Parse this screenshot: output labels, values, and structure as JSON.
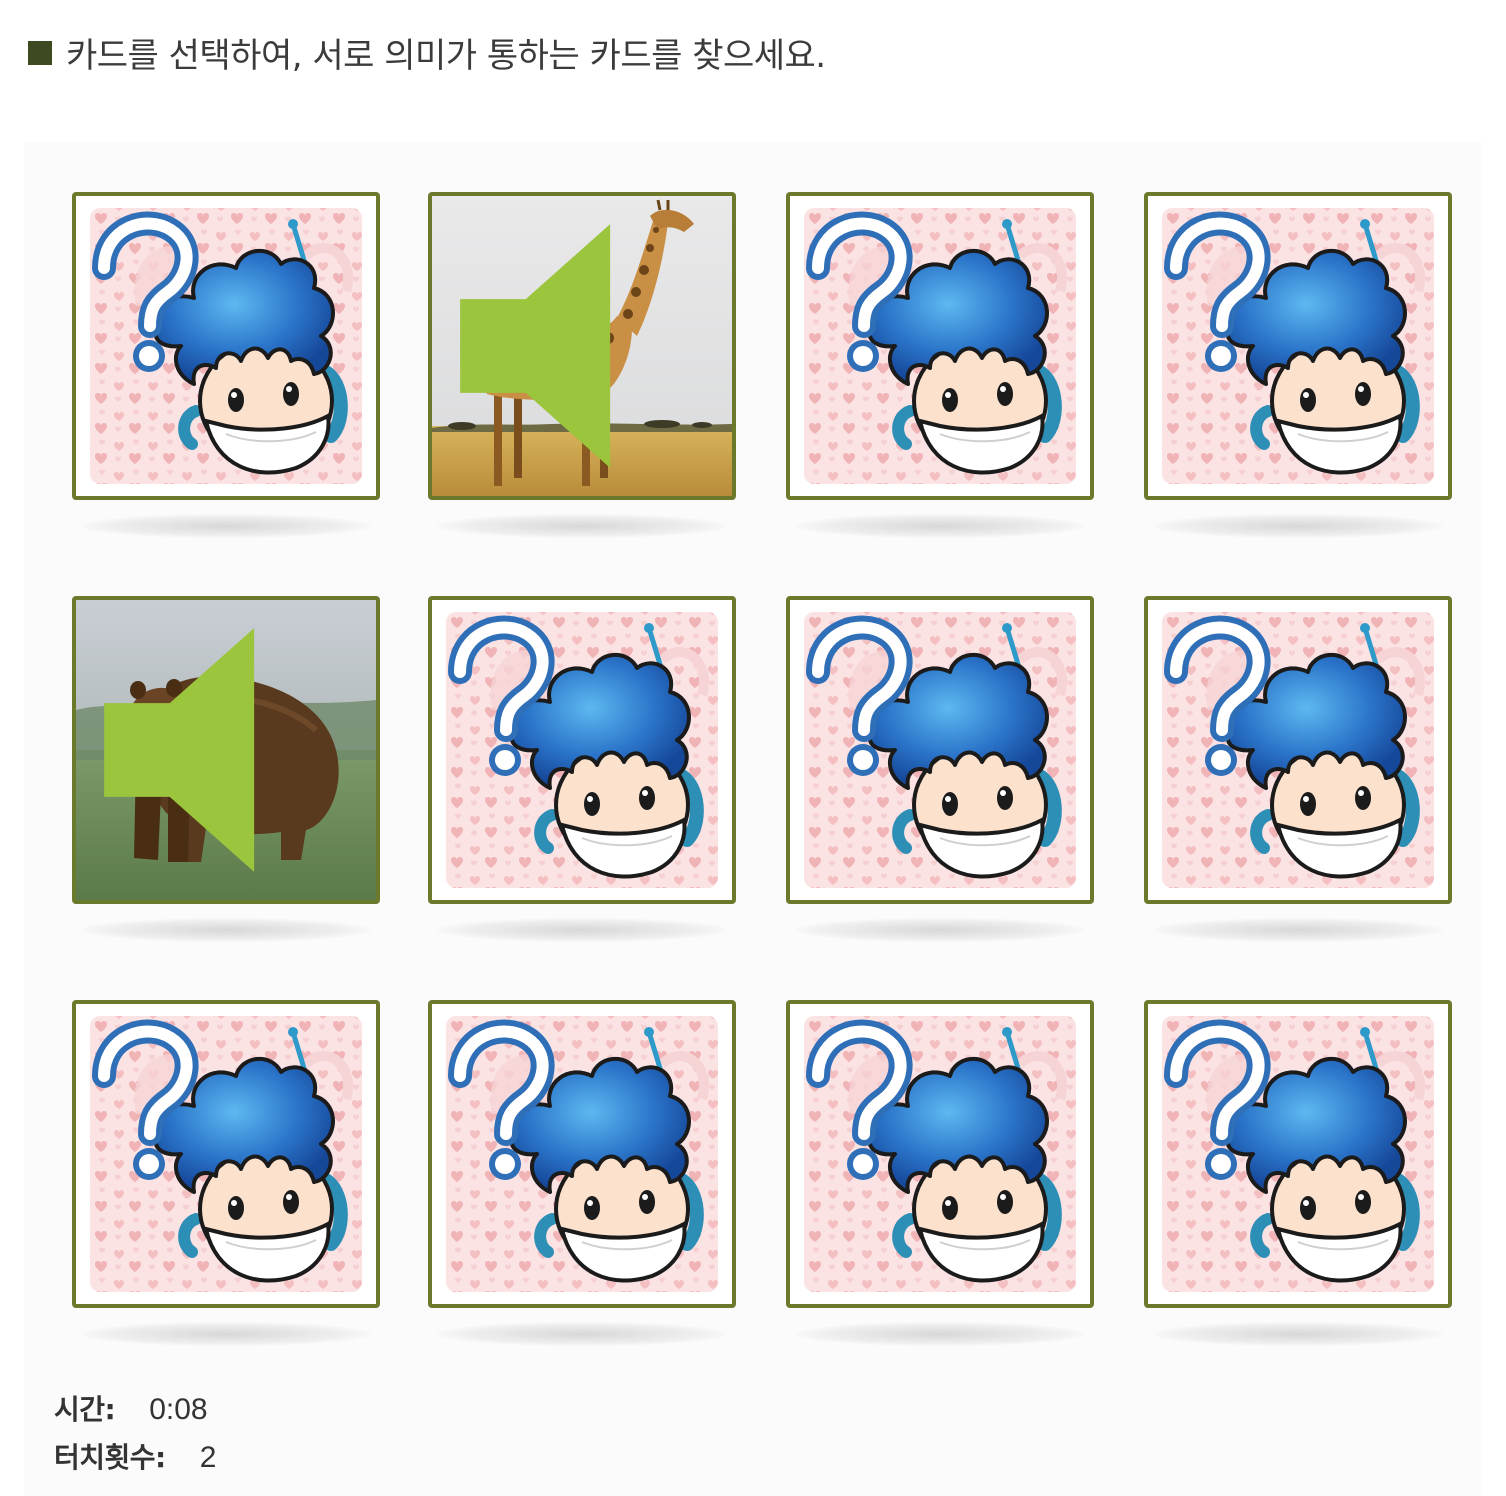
{
  "instruction": {
    "text": "카드를 선택하여, 서로 의미가 통하는 카드를 찾으세요."
  },
  "cards": [
    {
      "state": "face-down",
      "icon": "question-boy-icon"
    },
    {
      "state": "face-up",
      "icon": "giraffe-photo",
      "has_sound": true
    },
    {
      "state": "face-down",
      "icon": "question-boy-icon"
    },
    {
      "state": "face-down",
      "icon": "question-boy-icon"
    },
    {
      "state": "face-up",
      "icon": "bear-photo",
      "has_sound": true
    },
    {
      "state": "face-down",
      "icon": "question-boy-icon"
    },
    {
      "state": "face-down",
      "icon": "question-boy-icon"
    },
    {
      "state": "face-down",
      "icon": "question-boy-icon"
    },
    {
      "state": "face-down",
      "icon": "question-boy-icon"
    },
    {
      "state": "face-down",
      "icon": "question-boy-icon"
    },
    {
      "state": "face-down",
      "icon": "question-boy-icon"
    },
    {
      "state": "face-down",
      "icon": "question-boy-icon"
    }
  ],
  "stats": {
    "time_label": "시간:",
    "time_value": "0:08",
    "touch_label": "터치횟수:",
    "touch_value": "2"
  },
  "colors": {
    "card_border": "#6b7a2a",
    "bullet": "#3d4a22",
    "card_back_pink": "#f4c9cb",
    "hair_blue": "#2a74c9",
    "sound_icon": "#9bc53d"
  }
}
